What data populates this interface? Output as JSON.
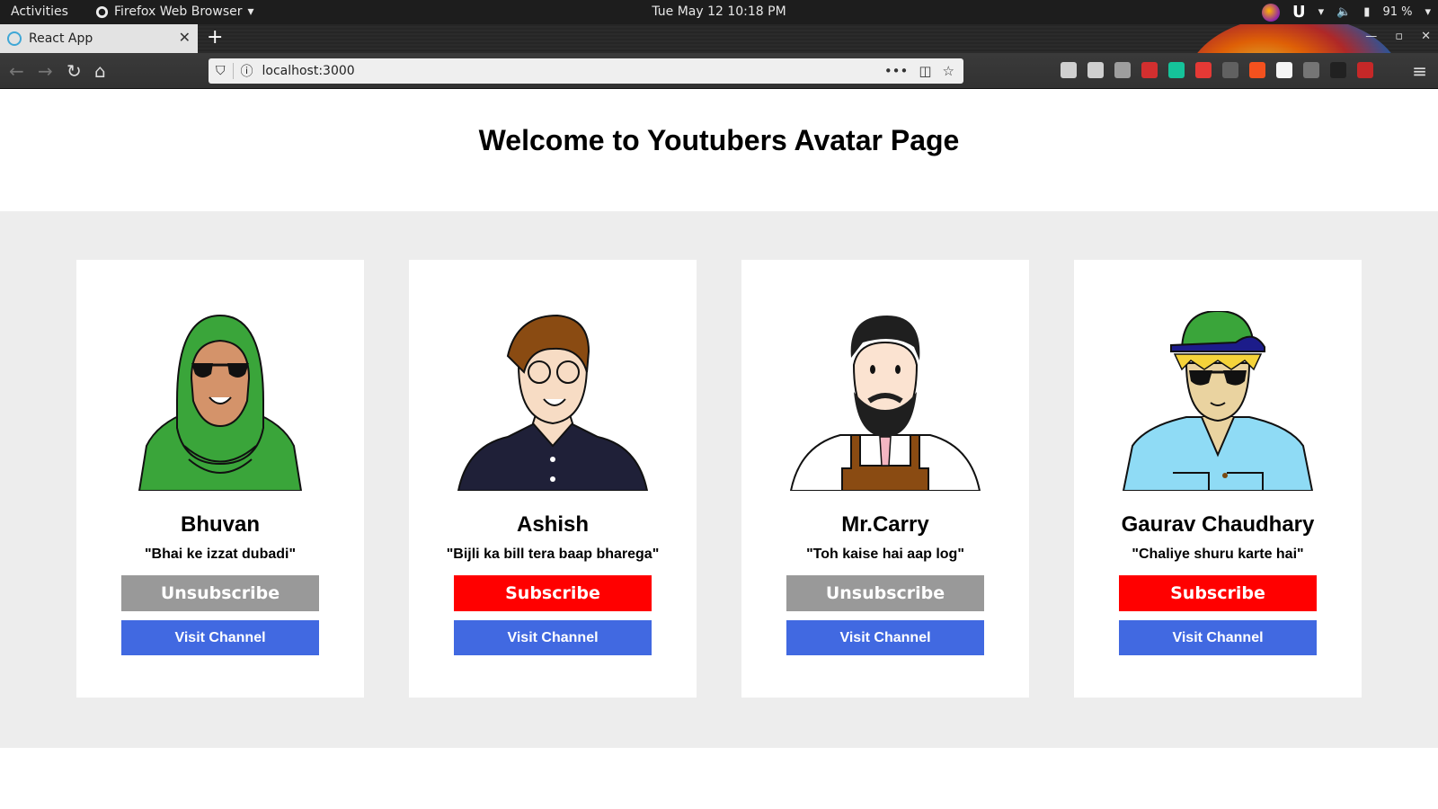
{
  "system_bar": {
    "activities": "Activities",
    "app_menu": "Firefox Web Browser",
    "clock": "Tue May 12  10:18 PM",
    "battery": "91 %"
  },
  "browser": {
    "tab_title": "React App",
    "url": "localhost:3000",
    "extensions": [
      {
        "icon": "library-icon",
        "color": "#cfcfcf"
      },
      {
        "icon": "reader-icon",
        "color": "#cfcfcf"
      },
      {
        "icon": "ext-gnome-icon",
        "color": "#9e9e9e"
      },
      {
        "icon": "adblock-icon",
        "color": "#d32f2f"
      },
      {
        "icon": "grammarly-icon",
        "color": "#15c39a"
      },
      {
        "icon": "ext-red-icon",
        "color": "#e53935"
      },
      {
        "icon": "ext-dark-icon",
        "color": "#616161"
      },
      {
        "icon": "ext-red2-icon",
        "color": "#f4511e"
      },
      {
        "icon": "ext-white-icon",
        "color": "#f5f5f5"
      },
      {
        "icon": "ext-gray-icon",
        "color": "#757575"
      },
      {
        "icon": "ext-paw-icon",
        "color": "#212121"
      },
      {
        "icon": "ext-circle-icon",
        "color": "#c62828"
      }
    ]
  },
  "page": {
    "title": "Welcome to Youtubers Avatar Page",
    "cards": [
      {
        "name": "Bhuvan",
        "quote": "\"Bhai ke izzat dubadi\"",
        "subscribe_label": "Unsubscribe",
        "subscribed": true,
        "visit_label": "Visit Channel",
        "avatar": "hijab-avatar"
      },
      {
        "name": "Ashish",
        "quote": "\"Bijli ka bill tera baap bharega\"",
        "subscribe_label": "Subscribe",
        "subscribed": false,
        "visit_label": "Visit Channel",
        "avatar": "glasses-avatar"
      },
      {
        "name": "Mr.Carry",
        "quote": "\"Toh kaise hai aap log\"",
        "subscribe_label": "Unsubscribe",
        "subscribed": true,
        "visit_label": "Visit Channel",
        "avatar": "beard-avatar"
      },
      {
        "name": "Gaurav Chaudhary",
        "quote": "\"Chaliye shuru karte hai\"",
        "subscribe_label": "Subscribe",
        "subscribed": false,
        "visit_label": "Visit Channel",
        "avatar": "cap-avatar"
      }
    ]
  },
  "colors": {
    "subscribe": "#ff0000",
    "unsubscribe": "#999999",
    "visit": "#4169e1",
    "band": "#ededed"
  }
}
